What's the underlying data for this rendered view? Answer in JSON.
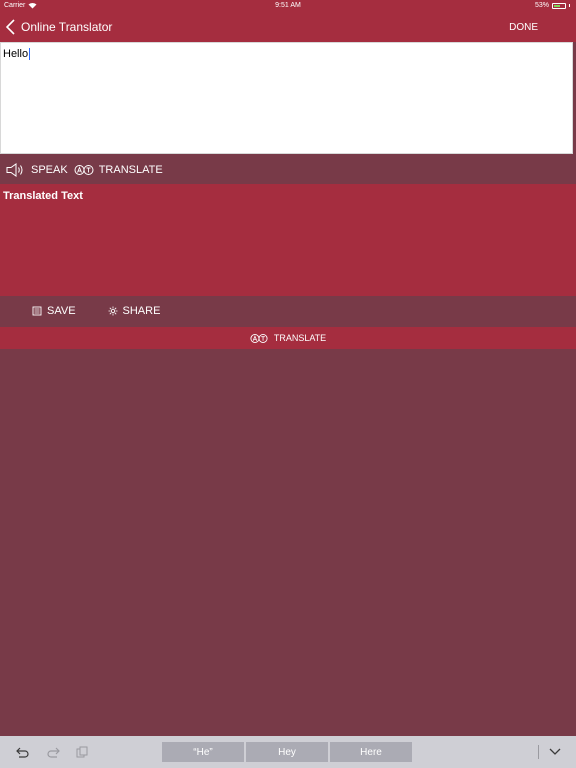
{
  "status_bar": {
    "carrier": "Carrier",
    "time": "9:51 AM",
    "battery": "53%"
  },
  "nav": {
    "back_label": "Online Translator",
    "done_label": "DONE"
  },
  "input": {
    "text": "Hello"
  },
  "actions": {
    "speak_label": "SPEAK",
    "translate_label": "TRANSLATE"
  },
  "output": {
    "title": "Translated Text"
  },
  "share_actions": {
    "save_label": "SAVE",
    "share_label": "SHARE"
  },
  "translate_bar": {
    "label": "TRANSLATE"
  },
  "keyboard": {
    "suggestions": [
      "“He”",
      "Hey",
      "Here"
    ]
  }
}
